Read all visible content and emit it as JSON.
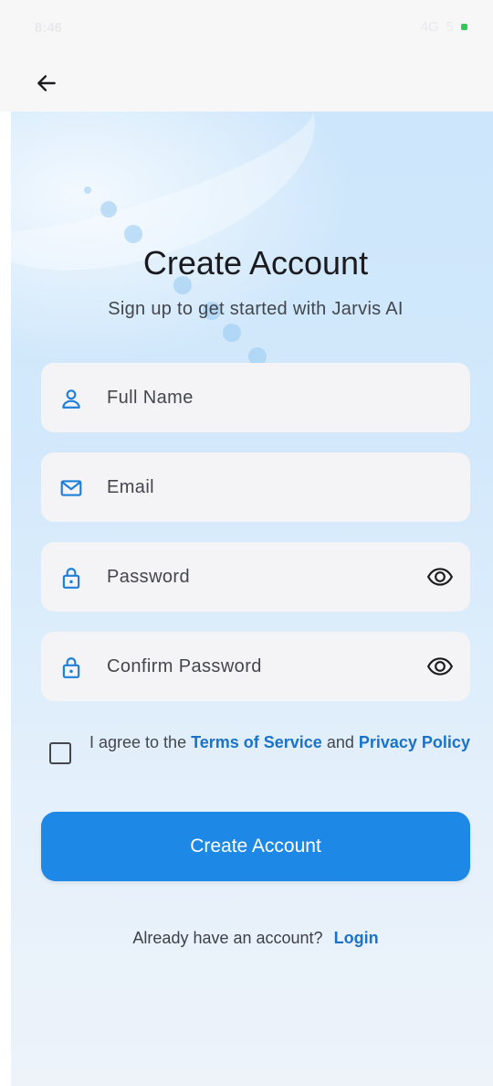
{
  "status_bar": {
    "time": "8:46",
    "network": "4G",
    "battery": "5"
  },
  "header": {
    "back_icon": "arrow-left-icon"
  },
  "page": {
    "title": "Create Account",
    "subtitle": "Sign up to get started with Jarvis AI"
  },
  "form": {
    "full_name": {
      "label": "Full Name",
      "icon": "person-icon"
    },
    "email": {
      "label": "Email",
      "icon": "mail-icon"
    },
    "password": {
      "label": "Password",
      "icon": "lock-icon",
      "toggle_icon": "eye-icon"
    },
    "confirm_password": {
      "label": "Confirm Password",
      "icon": "lock-icon",
      "toggle_icon": "eye-icon"
    }
  },
  "terms": {
    "prefix": "I agree to the ",
    "terms_link": "Terms of Service",
    "middle": " and ",
    "privacy_link": "Privacy Policy",
    "checked": false
  },
  "submit": {
    "label": "Create Account"
  },
  "login": {
    "prompt": "Already have an account?",
    "link": "Login"
  },
  "colors": {
    "accent": "#1d88e5",
    "link": "#1a73c8",
    "icon": "#1e7fd8",
    "field_bg": "#f4f4f7"
  }
}
